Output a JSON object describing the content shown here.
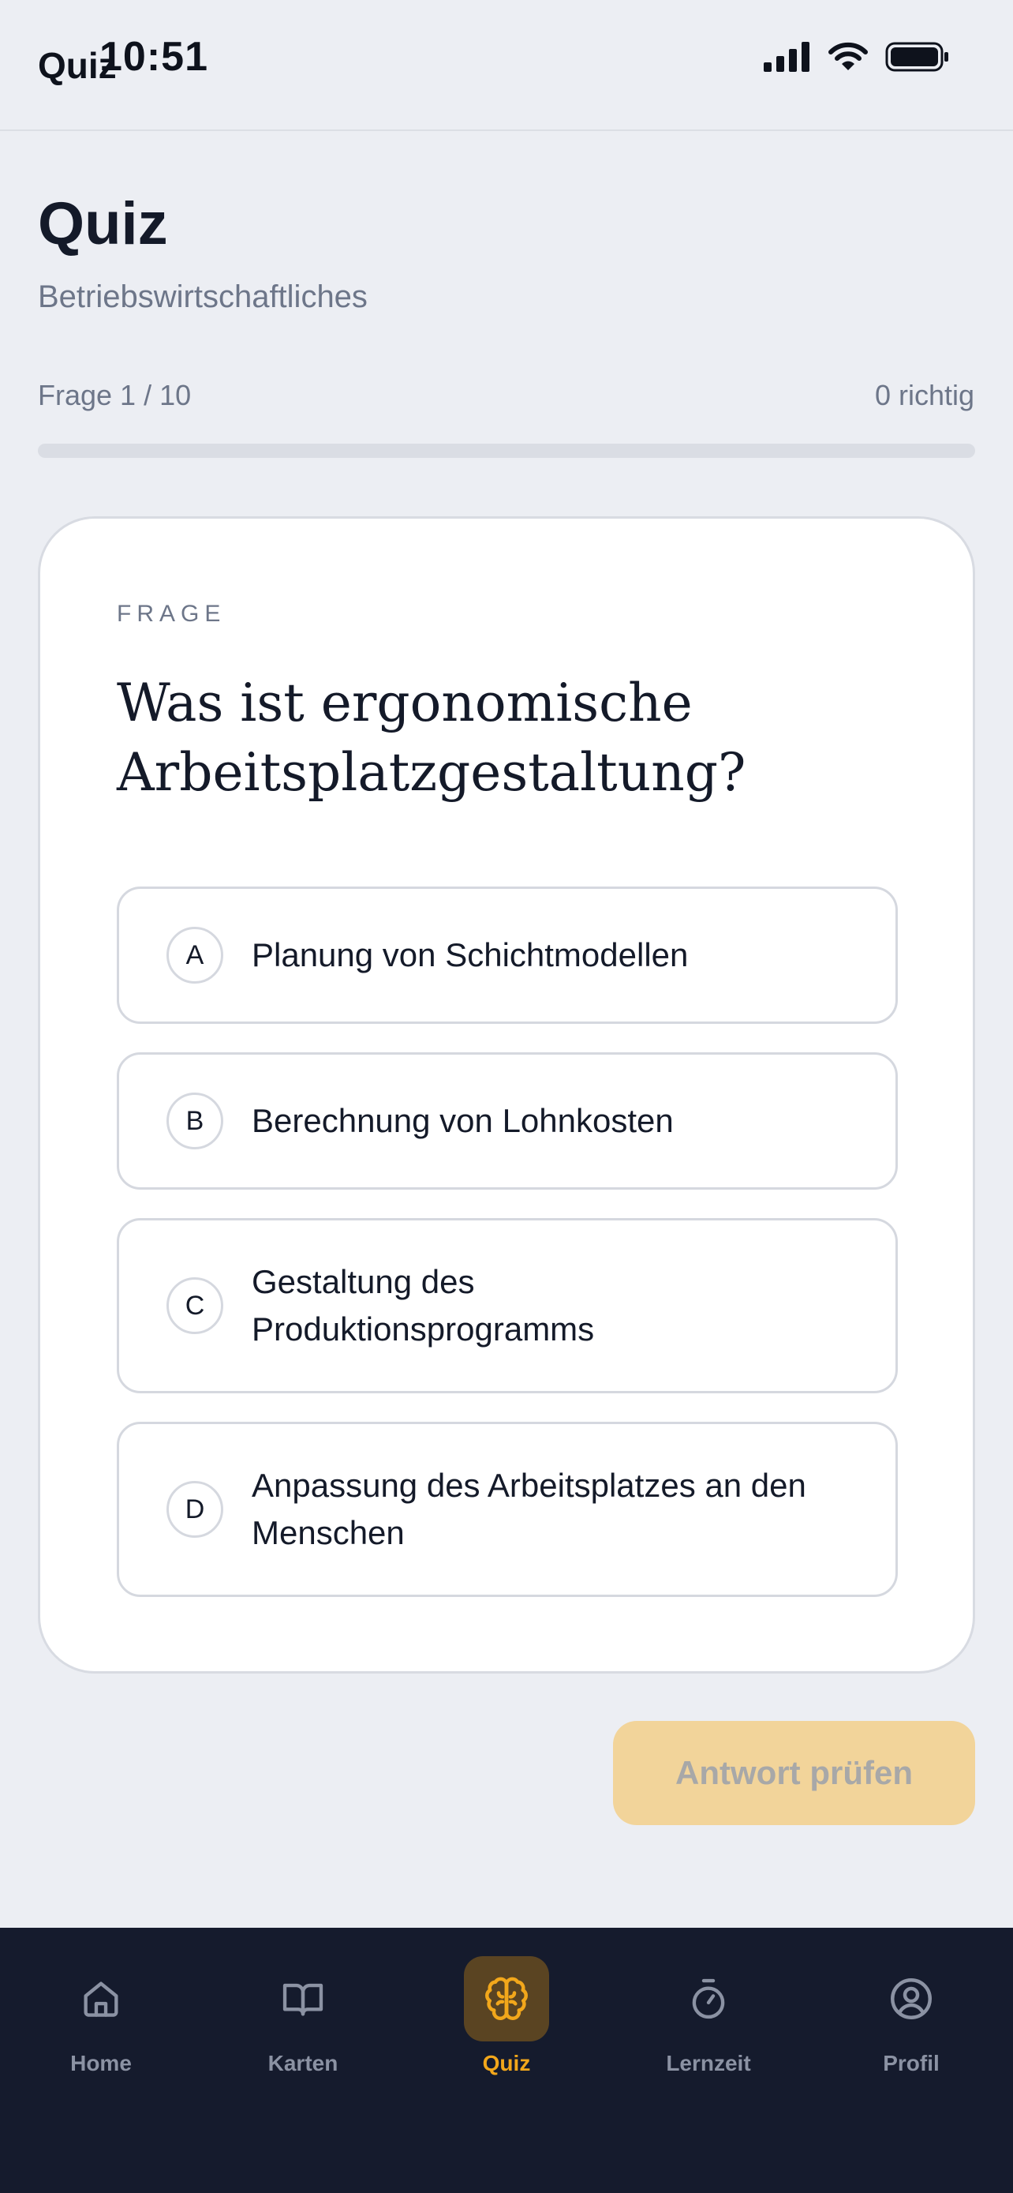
{
  "header": {
    "nav_title": "Quiz",
    "clock": "10:51"
  },
  "page": {
    "title": "Quiz",
    "subtitle": "Betriebswirtschaftliches"
  },
  "progress": {
    "label": "Frage 1 / 10",
    "score": "0 richtig",
    "fraction": 0
  },
  "question_card": {
    "eyebrow": "FRAGE",
    "question": "Was ist ergonomische Arbeitsplatzgestaltung?",
    "options": [
      {
        "letter": "A",
        "text": "Planung von Schichtmodellen"
      },
      {
        "letter": "B",
        "text": "Berechnung von Lohnkosten"
      },
      {
        "letter": "C",
        "text": "Gestaltung des Produktionsprogramms"
      },
      {
        "letter": "D",
        "text": "Anpassung des Arbeitsplatzes an den Menschen"
      }
    ]
  },
  "submit": {
    "label": "Antwort prüfen"
  },
  "tabbar": {
    "items": [
      {
        "label": "Home",
        "icon": "home-icon"
      },
      {
        "label": "Karten",
        "icon": "book-icon"
      },
      {
        "label": "Quiz",
        "icon": "brain-icon",
        "active": true
      },
      {
        "label": "Lernzeit",
        "icon": "stopwatch-icon"
      },
      {
        "label": "Profil",
        "icon": "profile-icon"
      }
    ]
  },
  "colors": {
    "accent": "#f2a71b",
    "background": "#eceef3",
    "tabbar": "#151b2d",
    "submit_disabled": "#f2d49a"
  }
}
